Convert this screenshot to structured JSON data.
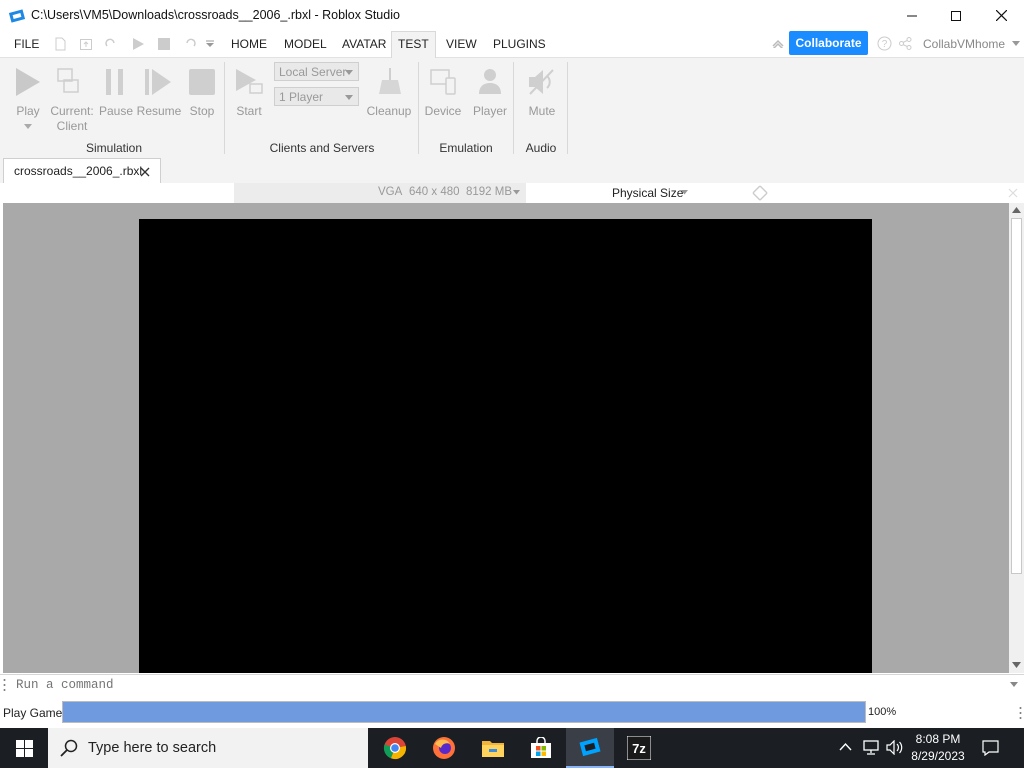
{
  "window": {
    "title": "C:\\Users\\VM5\\Downloads\\crossroads__2006_.rbxl - Roblox Studio"
  },
  "menu": {
    "file": "FILE",
    "tabs": [
      "HOME",
      "MODEL",
      "AVATAR",
      "TEST",
      "VIEW",
      "PLUGINS"
    ],
    "active_tab": "TEST",
    "collaborate": "Collaborate",
    "user": "CollabVMhome"
  },
  "ribbon": {
    "simulation": {
      "group": "Simulation",
      "play": "Play",
      "current_client_1": "Current:",
      "current_client_2": "Client",
      "pause": "Pause",
      "resume": "Resume",
      "stop": "Stop"
    },
    "clients_servers": {
      "group": "Clients and Servers",
      "start": "Start",
      "server_select": "Local Server",
      "player_select": "1 Player",
      "cleanup": "Cleanup"
    },
    "emulation": {
      "group": "Emulation",
      "device": "Device",
      "player": "Player"
    },
    "audio": {
      "group": "Audio",
      "mute": "Mute"
    }
  },
  "document_tab": {
    "label": "crossroads__2006_.rbxl"
  },
  "device_bar": {
    "device": "VGA",
    "resolution": "640 x 480",
    "memory": "8192 MB",
    "size_mode": "Physical Size"
  },
  "command_bar": {
    "placeholder": "Run a command"
  },
  "status": {
    "label": "Play Game",
    "progress_percent": 100,
    "progress_text": "100%"
  },
  "taskbar": {
    "search_placeholder": "Type here to search",
    "apps": [
      "chrome-icon",
      "firefox-icon",
      "file-explorer-icon",
      "microsoft-store-icon",
      "roblox-studio-icon",
      "7zip-icon"
    ],
    "time": "8:08 PM",
    "date": "8/29/2023"
  },
  "colors": {
    "accent": "#1a8cff",
    "progress": "#6f9ae0",
    "taskbar": "#1b1f24"
  }
}
